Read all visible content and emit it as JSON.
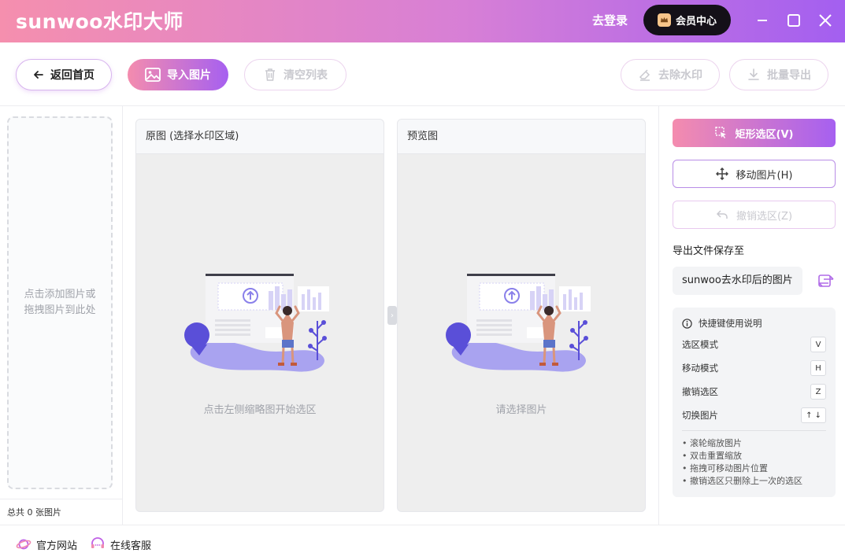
{
  "app": {
    "title": "sunwoo水印大师",
    "login_label": "去登录",
    "vip_label": "会员中心"
  },
  "toolbar": {
    "back_label": "返回首页",
    "import_label": "导入图片",
    "clear_label": "清空列表",
    "remove_wm_label": "去除水印",
    "batch_export_label": "批量导出"
  },
  "left": {
    "dropzone_line1": "点击添加图片或",
    "dropzone_line2": "拖拽图片到此处",
    "count": "总共 0 张图片"
  },
  "original_panel": {
    "title": "原图 (选择水印区域)",
    "hint": "点击左侧缩略图开始选区"
  },
  "preview_panel": {
    "title": "预览图",
    "hint": "请选择图片"
  },
  "right": {
    "rect_select_label": "矩形选区(V)",
    "move_label": "移动图片(H)",
    "undo_label": "撤销选区(Z)",
    "export_to_label": "导出文件保存至",
    "folder_name": "sunwoo去水印后的图片",
    "shortcuts_title": "快捷键使用说明",
    "shortcuts": [
      {
        "label": "选区模式",
        "key": "V"
      },
      {
        "label": "移动模式",
        "key": "H"
      },
      {
        "label": "撤销选区",
        "key": "Z"
      },
      {
        "label": "切换图片",
        "key": "↑ ↓"
      }
    ],
    "tips": [
      "• 滚轮缩放图片",
      "• 双击重置缩放",
      "• 拖拽可移动图片位置",
      "• 撤销选区只删除上一次的选区"
    ]
  },
  "footer": {
    "website_label": "官方网站",
    "service_label": "在线客服"
  },
  "colors": {
    "brand_start": "#f48cae",
    "brand_end": "#a660f0",
    "illustration_purple": "#6c5ce7"
  }
}
